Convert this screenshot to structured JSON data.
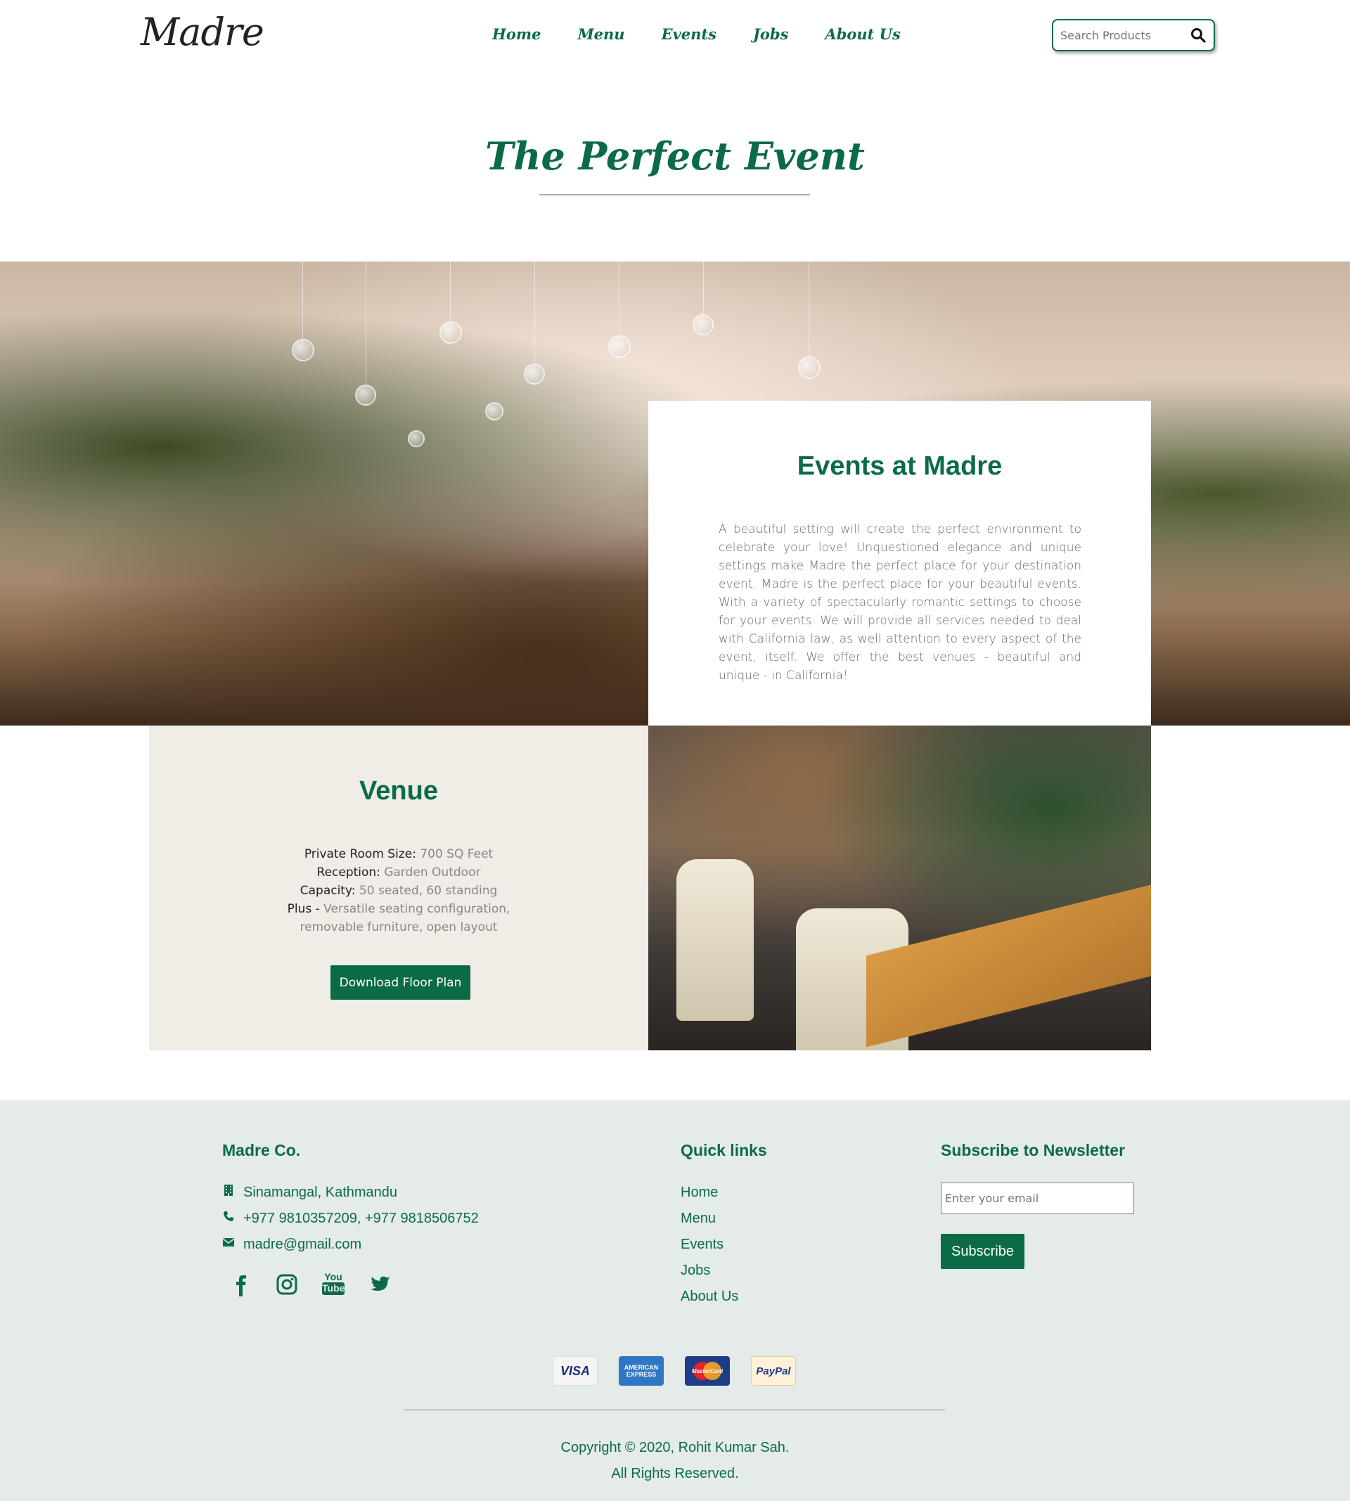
{
  "header": {
    "logo": "Madre",
    "nav": [
      "Home",
      "Menu",
      "Events",
      "Jobs",
      "About Us"
    ],
    "search_placeholder": "Search Products"
  },
  "page": {
    "title": "The Perfect Event"
  },
  "events": {
    "title": "Events at Madre",
    "text": "A beautiful setting will create the perfect environment to celebrate your love! Unquestioned elegance and unique settings make Madre the perfect place for your destination event. Madre is the perfect place for your beautiful events. With a variety of spectacularly romantic settings to choose for your events. We will provide all services needed to deal with California law, as well attention to every aspect of the event, itself. We offer the best venues - beautiful and unique - in California!"
  },
  "venue": {
    "title": "Venue",
    "room_size_label": "Private Room Size:",
    "room_size_value": "700 SQ Feet",
    "reception_label": "Reception:",
    "reception_value": "Garden Outdoor",
    "capacity_label": "Capacity:",
    "capacity_value": "50 seated, 60 standing",
    "plus_label": "Plus -",
    "plus_value_1": "Versatile seating configuration,",
    "plus_value_2": "removable furniture, open layout",
    "download_label": "Download Floor Plan"
  },
  "footer": {
    "company": "Madre Co.",
    "address": "Sinamangal, Kathmandu",
    "phone": "+977 9810357209, +977 9818506752",
    "email": "madre@gmail.com",
    "quick_links_title": "Quick links",
    "quick_links": [
      "Home",
      "Menu",
      "Events",
      "Jobs",
      "About Us"
    ],
    "newsletter_title": "Subscribe to Newsletter",
    "email_placeholder": "Enter your email",
    "subscribe_label": "Subscribe",
    "payments": {
      "visa": "VISA",
      "amex_1": "AMERICAN",
      "amex_2": "EXPRESS",
      "mastercard": "MasterCard",
      "paypal": "PayPal"
    },
    "social_youtube_1": "You",
    "social_youtube_2": "Tube",
    "copyright_1": "Copyright © 2020, Rohit Kumar Sah.",
    "copyright_2": "All Rights Reserved."
  },
  "colors": {
    "accent": "#0b6b47",
    "venue_bg": "#f0ece6",
    "footer_bg": "#e4ebe8"
  }
}
